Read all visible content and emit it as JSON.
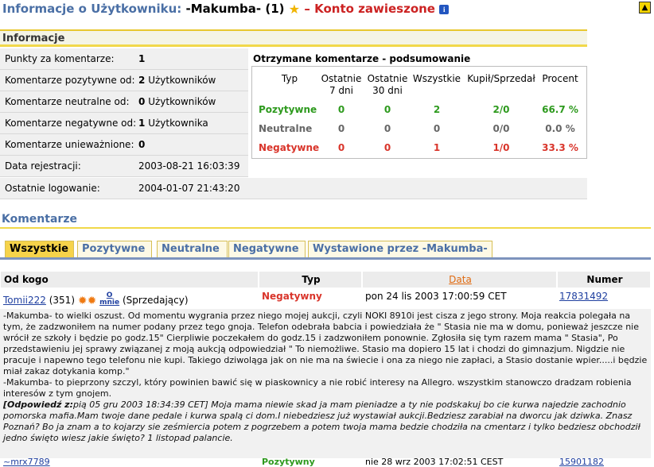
{
  "header": {
    "title": "Informacje o Użytkowniku:",
    "username": "-Makumba-",
    "count": "(1)",
    "status": "Konto zawieszone",
    "star": "★",
    "info": "i"
  },
  "info_section": {
    "title": "Informacje",
    "rows": [
      {
        "label": "Punkty za komentarze:",
        "value": "1",
        "suffix": ""
      },
      {
        "label": "Komentarze pozytywne od:",
        "value": "2",
        "suffix": "Użytkowników"
      },
      {
        "label": "Komentarze neutralne od:",
        "value": "0",
        "suffix": "Użytkowników"
      },
      {
        "label": "Komentarze negatywne od:",
        "value": "1",
        "suffix": "Użytkownika"
      },
      {
        "label": "Komentarze unieważnione:",
        "value": "0",
        "suffix": ""
      },
      {
        "label": "Data rejestracji:",
        "value": "2003-08-21 16:03:39",
        "suffix": ""
      }
    ],
    "last_login": {
      "label": "Ostatnie logowanie:",
      "value": "2004-01-07 21:43:20"
    }
  },
  "summary": {
    "title": "Otrzymane komentarze - podsumowanie",
    "headers": {
      "typ": "Typ",
      "last7a": "Ostatnie",
      "last7b": "7 dni",
      "last30a": "Ostatnie",
      "last30b": "30 dni",
      "all": "Wszystkie",
      "buysell": "Kupił/Sprzedał",
      "percent": "Procent"
    },
    "rows": [
      {
        "type": "Pozytywne",
        "d7": "0",
        "d30": "0",
        "all": "2",
        "bs": "2/0",
        "pct": "66.7 %"
      },
      {
        "type": "Neutralne",
        "d7": "0",
        "d30": "0",
        "all": "0",
        "bs": "0/0",
        "pct": "0.0 %"
      },
      {
        "type": "Negatywne",
        "d7": "0",
        "d30": "0",
        "all": "1",
        "bs": "1/0",
        "pct": "33.3 %"
      }
    ]
  },
  "comments": {
    "title": "Komentarze",
    "tabs": [
      "Wszystkie",
      "Pozytywne",
      "Neutralne",
      "Negatywne",
      "Wystawione przez -Makumba-"
    ],
    "columns": {
      "from": "Od kogo",
      "type": "Typ",
      "date": "Data",
      "number": "Numer"
    },
    "entry1": {
      "user": "Tomii222",
      "score": "(351)",
      "mnie_top": "O",
      "mnie": "mnie",
      "role": "(Sprzedający)",
      "type": "Negatywny",
      "date": "pon 24 lis 2003 17:00:59 CET",
      "number": "17831492",
      "text1": "-Makumba- to wielki oszust. Od momentu wygrania przez niego mojej aukcji, czyli NOKI 8910i jest cisza z jego strony. Moja reakcia polegała na tym, że zadzwoniłem na numer podany przez tego gnoja. Telefon odebrała babcia i powiedziała że \" Stasia nie ma w domu, ponieważ jeszcze nie wrócił ze szkoły i będzie po godz.15\" Cierpliwie poczekałem do godz.15 i zadzwoniłem ponownie. Zgłosiła się tym razem mama \" Stasia\", Po przedstawieniu jej sprawy związanej z moją aukcją odpowiedział \" To niemożliwe. Stasio ma dopiero 15 lat i chodzi do gimnazjum. Nigdzie nie pracuje i napewno tego telefonu nie kupi. Takiego dziwoląga jak on nie ma na świecie i ona za niego nie zapłaci, a Stasio dostanie wpier.....i będzie miał zakaz dotykania komp.\"",
      "text2": "-Makumba- to pieprzony szczyl, który powinien bawić się w piaskownicy a nie robić interesy na Allegro. wszystkim stanowczo dradzam robienia interesów z tym gnojem.",
      "answer_label": "[Odpowiedź z:",
      "answer_date": "pią 05 gru 2003 18:34:39 CET]",
      "answer_text": "Moja mama niewie skad ja mam pieniadze a ty nie podskakuj bo cie kurwa najedzie zachodnio pomorska mafia.Mam twoje dane pedale i kurwa spalą ci dom.I niebedziesz już wystawiał aukcji.Bedziesz zarabiał na dworcu jak dziwka. Znasz Poznań? Bo ja znam a to kojarzy sie ześmiercia potem z pogrzebem a potem twoja mama bedzie chodziła na cmentarz i tylko bedziesz obchodził jedno święto wiesz jakie święto? 1 listopad palancie."
    },
    "entry2": {
      "user": "~mrx7789",
      "type": "Pozytywny",
      "date": "nie 28 wrz 2003 17:02:51 CEST",
      "number": "15901182"
    }
  }
}
